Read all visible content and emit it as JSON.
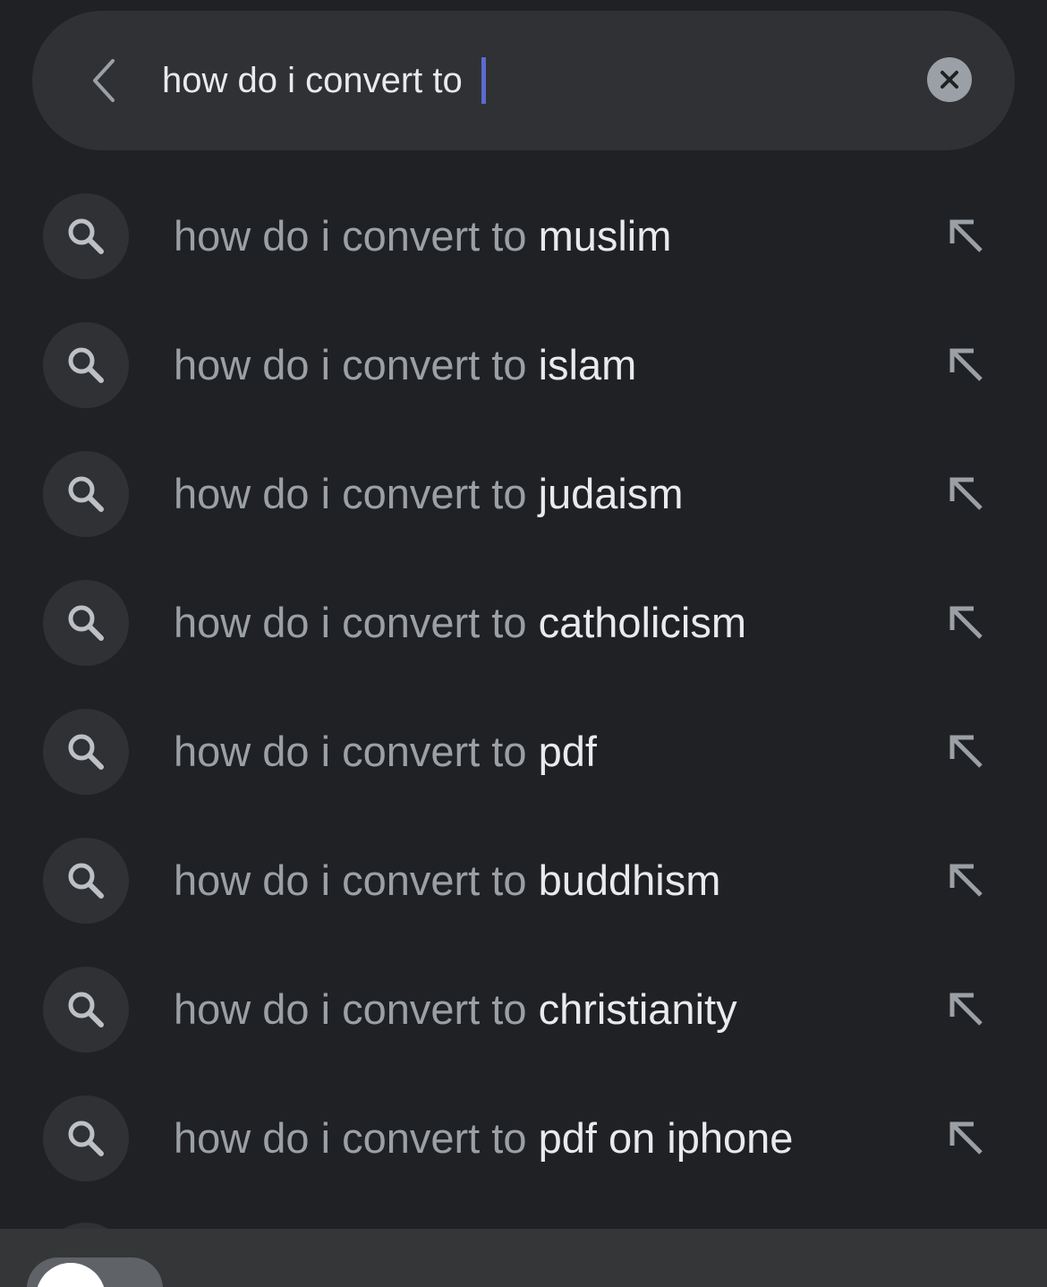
{
  "search": {
    "query": "how do i convert to ",
    "back_icon": "chevron-left-icon",
    "clear_icon": "close-icon"
  },
  "suggestions": [
    {
      "prefix": "how do i convert to ",
      "completion": "muslim"
    },
    {
      "prefix": "how do i convert to ",
      "completion": "islam"
    },
    {
      "prefix": "how do i convert to ",
      "completion": "judaism"
    },
    {
      "prefix": "how do i convert to ",
      "completion": "catholicism"
    },
    {
      "prefix": "how do i convert to ",
      "completion": "pdf"
    },
    {
      "prefix": "how do i convert to ",
      "completion": "buddhism"
    },
    {
      "prefix": "how do i convert to ",
      "completion": "christianity"
    },
    {
      "prefix": "how do i convert to ",
      "completion": "pdf on iphone"
    }
  ],
  "icons": {
    "suggestion_icon": "search-icon",
    "fill_icon": "arrow-up-left-icon"
  },
  "colors": {
    "background": "#202124",
    "surface": "#303134",
    "text_primary": "#e8eaed",
    "text_secondary": "#9aa0a6",
    "caret": "#5b6bd0"
  }
}
